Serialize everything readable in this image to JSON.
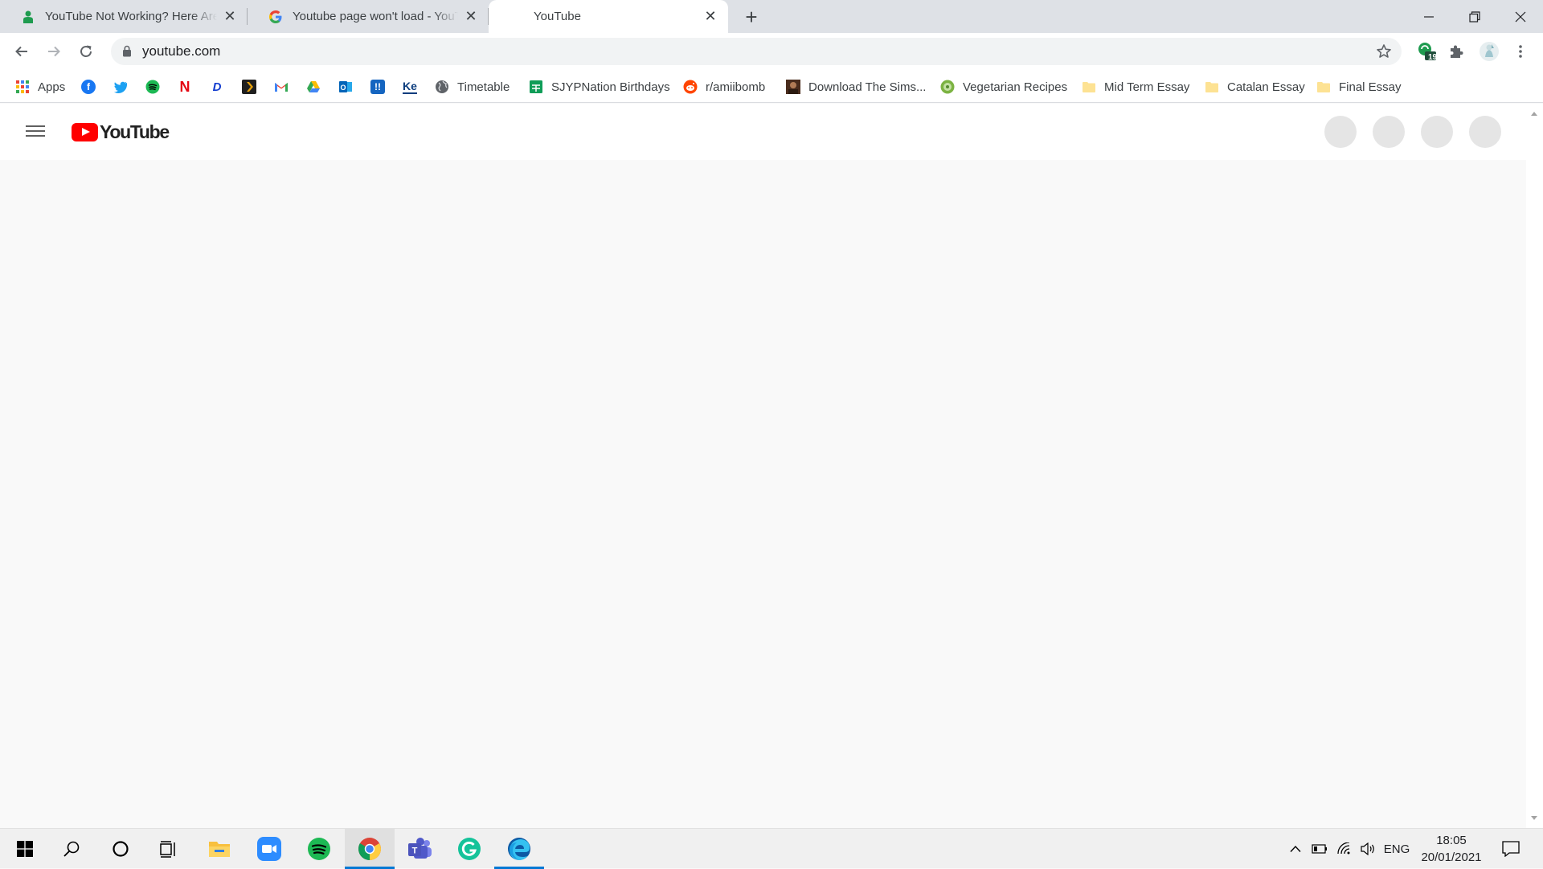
{
  "tabs": [
    {
      "title": "YouTube Not Working? Here Are",
      "favicon": "green-person-icon",
      "state": "inactive"
    },
    {
      "title": "Youtube page won't load - YouTu",
      "favicon": "google-g-icon",
      "state": "inactive"
    },
    {
      "title": "YouTube",
      "favicon": "none",
      "state": "active"
    }
  ],
  "toolbar": {
    "url": "youtube.com",
    "extension_badge": "19"
  },
  "bookmarks": [
    {
      "label": "Apps",
      "icon": "apps-grid-icon"
    },
    {
      "label": "",
      "icon": "facebook-icon"
    },
    {
      "label": "",
      "icon": "twitter-icon"
    },
    {
      "label": "",
      "icon": "spotify-icon"
    },
    {
      "label": "",
      "icon": "netflix-icon"
    },
    {
      "label": "",
      "icon": "disney-plus-icon"
    },
    {
      "label": "",
      "icon": "plex-icon"
    },
    {
      "label": "",
      "icon": "gmail-icon"
    },
    {
      "label": "",
      "icon": "google-drive-icon"
    },
    {
      "label": "",
      "icon": "outlook-icon"
    },
    {
      "label": "",
      "icon": "ticket-app-icon"
    },
    {
      "label": "",
      "icon": "ke-icon"
    },
    {
      "label": "Timetable",
      "icon": "globe-icon"
    },
    {
      "label": "SJYPNation Birthdays",
      "icon": "sheets-icon"
    },
    {
      "label": "r/amiibomb",
      "icon": "reddit-icon"
    },
    {
      "label": "Download The Sims...",
      "icon": "site-thumbnail-icon"
    },
    {
      "label": "Vegetarian Recipes",
      "icon": "recipe-site-icon"
    },
    {
      "label": "Mid Term Essay",
      "icon": "folder-icon"
    },
    {
      "label": "Catalan Essay",
      "icon": "folder-icon"
    },
    {
      "label": "Final Essay",
      "icon": "folder-icon"
    }
  ],
  "page": {
    "logo_text": "YouTube"
  },
  "taskbar": {
    "language": "ENG",
    "time": "18:05",
    "date": "20/01/2021"
  },
  "colors": {
    "tabstrip": "#dee1e6",
    "youtube_red": "#ff0000",
    "taskbar_accent": "#0078d4",
    "page_background": "#f9f9f9"
  }
}
